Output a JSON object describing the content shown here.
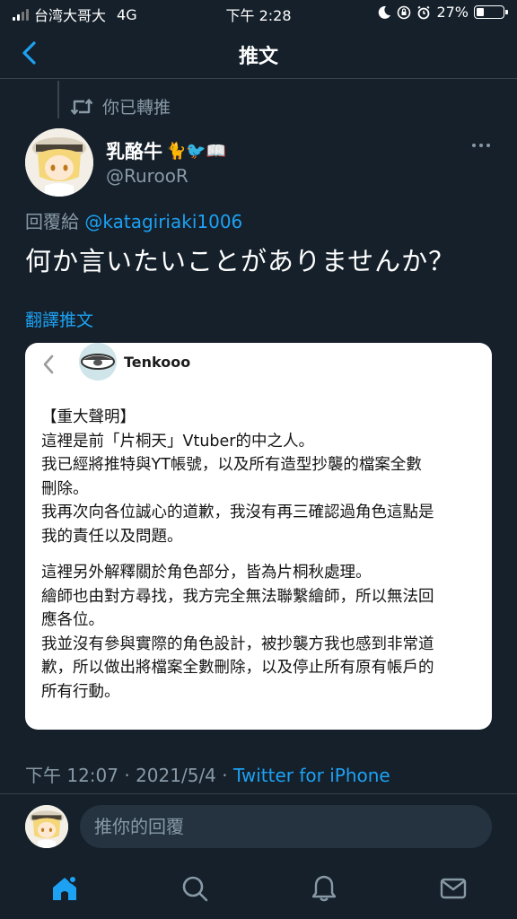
{
  "status_bar": {
    "carrier": "台湾大哥大",
    "network": "4G",
    "time": "下午 2:28",
    "battery": "27%",
    "battery_level": 0.27
  },
  "nav": {
    "title": "推文"
  },
  "retweet": {
    "label": "你已轉推"
  },
  "author": {
    "name": "乳酪牛",
    "emojis": "🐈🐦📖",
    "handle": "@RurooR"
  },
  "reply_to": {
    "prefix": "回覆給",
    "target": "@katagiriaki1006"
  },
  "tweet": {
    "text": "何か言いたいことがありませんか？",
    "translate_label": "翻譯推文"
  },
  "card": {
    "name": "Tenkooo",
    "lines": [
      "【重大聲明】",
      "這裡是前「片桐天」Vtuber的中之人。",
      "我已經將推特與YT帳號，以及所有造型抄襲的檔案全數",
      "刪除。",
      "我再次向各位誠心的道歉，我沒有再三確認過角色這點是",
      "我的責任以及問題。",
      "這裡另外解釋關於角色部分，皆為片桐秋處理。",
      "繪師也由對方尋找，我方完全無法聯繫繪師，所以無法回",
      "應各位。",
      "我並沒有參與實際的角色設計，被抄襲方我也感到非常道",
      "歉，所以做出將檔案全數刪除，以及停止所有原有帳戶的",
      "所有行動。"
    ]
  },
  "meta": {
    "time": "下午 12:07",
    "sep1": " · ",
    "date": "2021/5/4",
    "sep2": " · ",
    "source": "Twitter for iPhone"
  },
  "reply_bar": {
    "placeholder": "推你的回覆"
  },
  "tabs": {
    "home": "home-icon",
    "search": "search-icon",
    "notifications": "bell-icon",
    "messages": "mail-icon",
    "accent": "#1da1f2"
  }
}
